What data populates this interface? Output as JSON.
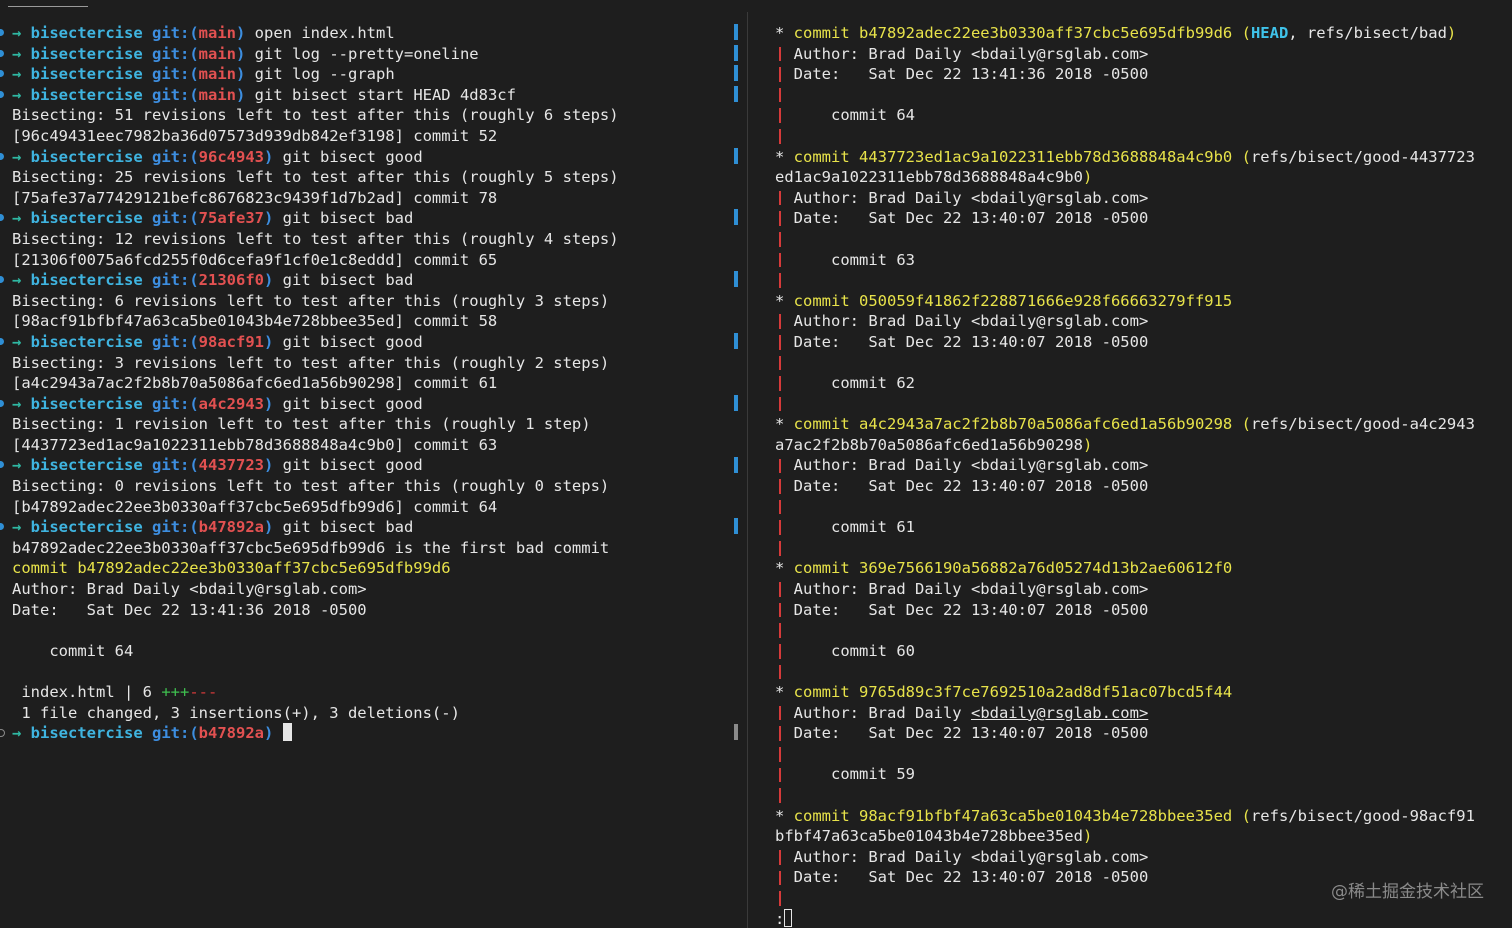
{
  "left": {
    "lines": [
      {
        "kind": "prompt",
        "dir": "bisectercise",
        "git": "git:(",
        "branch": "main",
        "close": ")",
        "cmd": " open index.html"
      },
      {
        "kind": "prompt",
        "dir": "bisectercise",
        "git": "git:(",
        "branch": "main",
        "close": ")",
        "cmd": " git log --pretty=oneline"
      },
      {
        "kind": "prompt",
        "dir": "bisectercise",
        "git": "git:(",
        "branch": "main",
        "close": ")",
        "cmd": " git log --graph"
      },
      {
        "kind": "prompt",
        "dir": "bisectercise",
        "git": "git:(",
        "branch": "main",
        "close": ")",
        "cmd": " git bisect start HEAD 4d83cf"
      },
      {
        "kind": "out",
        "text": "Bisecting: 51 revisions left to test after this (roughly 6 steps)"
      },
      {
        "kind": "out",
        "text": "[96c49431eec7982ba36d07573d939db842ef3198] commit 52"
      },
      {
        "kind": "prompt",
        "dir": "bisectercise",
        "git": "git:(",
        "branch": "96c4943",
        "close": ")",
        "cmd": " git bisect good"
      },
      {
        "kind": "out",
        "text": "Bisecting: 25 revisions left to test after this (roughly 5 steps)"
      },
      {
        "kind": "out",
        "text": "[75afe37a77429121befc8676823c9439f1d7b2ad] commit 78"
      },
      {
        "kind": "prompt",
        "dir": "bisectercise",
        "git": "git:(",
        "branch": "75afe37",
        "close": ")",
        "cmd": " git bisect bad"
      },
      {
        "kind": "out",
        "text": "Bisecting: 12 revisions left to test after this (roughly 4 steps)"
      },
      {
        "kind": "out",
        "text": "[21306f0075a6fcd255f0d6cefa9f1cf0e1c8eddd] commit 65"
      },
      {
        "kind": "prompt",
        "dir": "bisectercise",
        "git": "git:(",
        "branch": "21306f0",
        "close": ")",
        "cmd": " git bisect bad"
      },
      {
        "kind": "out",
        "text": "Bisecting: 6 revisions left to test after this (roughly 3 steps)"
      },
      {
        "kind": "out",
        "text": "[98acf91bfbf47a63ca5be01043b4e728bbee35ed] commit 58"
      },
      {
        "kind": "prompt",
        "dir": "bisectercise",
        "git": "git:(",
        "branch": "98acf91",
        "close": ")",
        "cmd": " git bisect good"
      },
      {
        "kind": "out",
        "text": "Bisecting: 3 revisions left to test after this (roughly 2 steps)"
      },
      {
        "kind": "out",
        "text": "[a4c2943a7ac2f2b8b70a5086afc6ed1a56b90298] commit 61"
      },
      {
        "kind": "prompt",
        "dir": "bisectercise",
        "git": "git:(",
        "branch": "a4c2943",
        "close": ")",
        "cmd": " git bisect good"
      },
      {
        "kind": "out",
        "text": "Bisecting: 1 revision left to test after this (roughly 1 step)"
      },
      {
        "kind": "out",
        "text": "[4437723ed1ac9a1022311ebb78d3688848a4c9b0] commit 63"
      },
      {
        "kind": "prompt",
        "dir": "bisectercise",
        "git": "git:(",
        "branch": "4437723",
        "close": ")",
        "cmd": " git bisect good"
      },
      {
        "kind": "out",
        "text": "Bisecting: 0 revisions left to test after this (roughly 0 steps)"
      },
      {
        "kind": "out",
        "text": "[b47892adec22ee3b0330aff37cbc5e695dfb99d6] commit 64"
      },
      {
        "kind": "prompt",
        "dir": "bisectercise",
        "git": "git:(",
        "branch": "b47892a",
        "close": ")",
        "cmd": " git bisect bad"
      },
      {
        "kind": "out",
        "text": "b47892adec22ee3b0330aff37cbc5e695dfb99d6 is the first bad commit"
      },
      {
        "kind": "yellow",
        "text": "commit b47892adec22ee3b0330aff37cbc5e695dfb99d6"
      },
      {
        "kind": "out",
        "text": "Author: Brad Daily <bdaily@rsglab.com>"
      },
      {
        "kind": "out",
        "text": "Date:   Sat Dec 22 13:41:36 2018 -0500"
      },
      {
        "kind": "out",
        "text": ""
      },
      {
        "kind": "out",
        "text": "    commit 64"
      },
      {
        "kind": "out",
        "text": ""
      },
      {
        "kind": "stat",
        "file": " index.html | 6 ",
        "plus": "+++",
        "minus": "---"
      },
      {
        "kind": "out",
        "text": " 1 file changed, 3 insertions(+), 3 deletions(-)"
      },
      {
        "kind": "current",
        "dir": "bisectercise",
        "git": "git:(",
        "branch": "b47892a",
        "close": ")"
      }
    ]
  },
  "right": {
    "lines": [
      {
        "kind": "commit",
        "star": "* ",
        "label": "commit b47892adec22ee3b0330aff37cbc5e695dfb99d6",
        "ref_open": " (",
        "head": "HEAD",
        "refs": ", refs/bisect/bad",
        "ref_close": ")"
      },
      {
        "kind": "detail",
        "text": "Author: Brad Daily <bdaily@rsglab.com>"
      },
      {
        "kind": "detail",
        "text": "Date:   Sat Dec 22 13:41:36 2018 -0500"
      },
      {
        "kind": "detail",
        "text": ""
      },
      {
        "kind": "detail",
        "text": "    commit 64"
      },
      {
        "kind": "detail",
        "text": ""
      },
      {
        "kind": "commit",
        "star": "* ",
        "label": "commit 4437723ed1ac9a1022311ebb78d3688848a4c9b0",
        "ref_open": " (",
        "refs": "refs/bisect/good-4437723"
      },
      {
        "kind": "wrap",
        "text": "ed1ac9a1022311ebb78d3688848a4c9b0",
        "close": ")"
      },
      {
        "kind": "detail",
        "text": "Author: Brad Daily <bdaily@rsglab.com>"
      },
      {
        "kind": "detail",
        "text": "Date:   Sat Dec 22 13:40:07 2018 -0500"
      },
      {
        "kind": "detail",
        "text": ""
      },
      {
        "kind": "detail",
        "text": "    commit 63"
      },
      {
        "kind": "detail",
        "text": ""
      },
      {
        "kind": "commit",
        "star": "* ",
        "label": "commit 050059f41862f228871666e928f66663279ff915"
      },
      {
        "kind": "detail",
        "text": "Author: Brad Daily <bdaily@rsglab.com>"
      },
      {
        "kind": "detail",
        "text": "Date:   Sat Dec 22 13:40:07 2018 -0500"
      },
      {
        "kind": "detail",
        "text": ""
      },
      {
        "kind": "detail",
        "text": "    commit 62"
      },
      {
        "kind": "detail",
        "text": ""
      },
      {
        "kind": "commit",
        "star": "* ",
        "label": "commit a4c2943a7ac2f2b8b70a5086afc6ed1a56b90298",
        "ref_open": " (",
        "refs": "refs/bisect/good-a4c2943"
      },
      {
        "kind": "wrap",
        "text": "a7ac2f2b8b70a5086afc6ed1a56b90298",
        "close": ")"
      },
      {
        "kind": "detail",
        "text": "Author: Brad Daily <bdaily@rsglab.com>"
      },
      {
        "kind": "detail",
        "text": "Date:   Sat Dec 22 13:40:07 2018 -0500"
      },
      {
        "kind": "detail",
        "text": ""
      },
      {
        "kind": "detail",
        "text": "    commit 61"
      },
      {
        "kind": "detail",
        "text": ""
      },
      {
        "kind": "commit",
        "star": "* ",
        "label": "commit 369e7566190a56882a76d05274d13b2ae60612f0"
      },
      {
        "kind": "detail",
        "text": "Author: Brad Daily <bdaily@rsglab.com>"
      },
      {
        "kind": "detail",
        "text": "Date:   Sat Dec 22 13:40:07 2018 -0500"
      },
      {
        "kind": "detail",
        "text": ""
      },
      {
        "kind": "detail",
        "text": "    commit 60"
      },
      {
        "kind": "detail",
        "text": ""
      },
      {
        "kind": "commit",
        "star": "* ",
        "label": "commit 9765d89c3f7ce7692510a2ad8df51ac07bcd5f44"
      },
      {
        "kind": "detail-link",
        "prefix": "Author: Brad Daily ",
        "link": "<bdaily@rsglab.com>"
      },
      {
        "kind": "detail",
        "text": "Date:   Sat Dec 22 13:40:07 2018 -0500"
      },
      {
        "kind": "detail",
        "text": ""
      },
      {
        "kind": "detail",
        "text": "    commit 59"
      },
      {
        "kind": "detail",
        "text": ""
      },
      {
        "kind": "commit",
        "star": "* ",
        "label": "commit 98acf91bfbf47a63ca5be01043b4e728bbee35ed",
        "ref_open": " (",
        "refs": "refs/bisect/good-98acf91"
      },
      {
        "kind": "wrap",
        "text": "bfbf47a63ca5be01043b4e728bbee35ed",
        "close": ")"
      },
      {
        "kind": "detail",
        "text": "Author: Brad Daily <bdaily@rsglab.com>"
      },
      {
        "kind": "detail",
        "text": "Date:   Sat Dec 22 13:40:07 2018 -0500"
      },
      {
        "kind": "detail",
        "text": ""
      },
      {
        "kind": "pager",
        "text": ":"
      }
    ]
  },
  "watermark": "@稀土掘金技术社区",
  "colors": {
    "background": "#1e1e1e",
    "prompt_arrow": "#2fb8a3",
    "directory": "#3fb4e0",
    "git_label": "#3d8ee0",
    "branch": "#e25151",
    "commit_hash": "#e8e34a",
    "head_ref": "#3fc3ea",
    "graph_line": "#d63a3a",
    "insertions": "#3fc04f",
    "deletions": "#d63a3a"
  },
  "icons": {
    "prompt_arrow": "arrow-right-icon",
    "prompt_marker": "prompt-marker-icon",
    "cursor": "block-cursor-icon"
  }
}
